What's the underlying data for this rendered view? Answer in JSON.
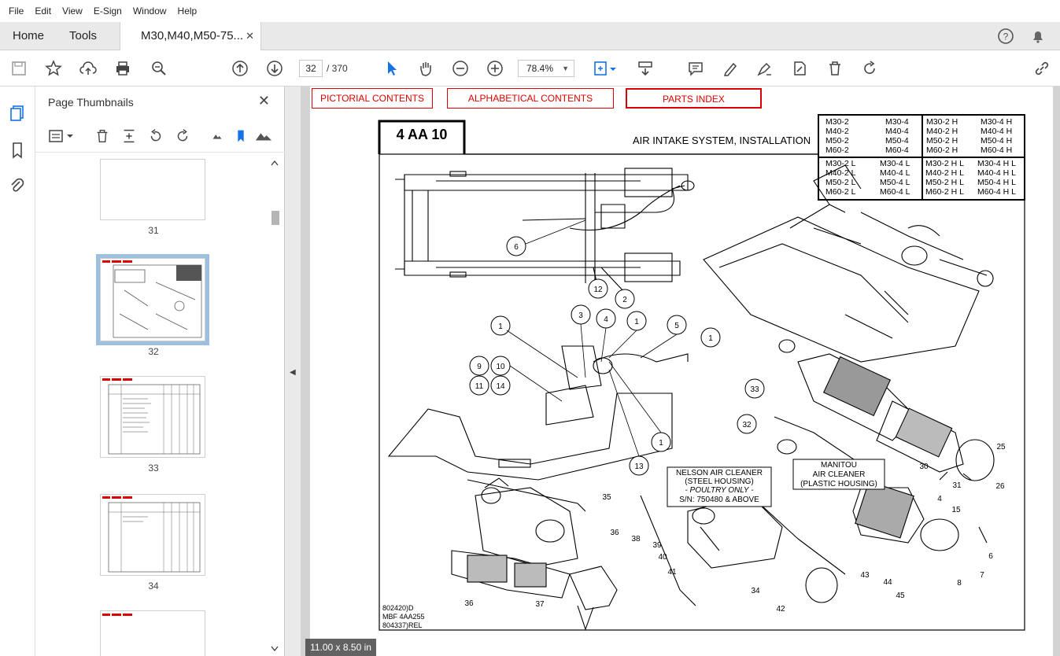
{
  "menu": [
    "File",
    "Edit",
    "View",
    "E-Sign",
    "Window",
    "Help"
  ],
  "tabs": {
    "home": "Home",
    "tools": "Tools",
    "document": "M30,M40,M50-75...",
    "close": "✕"
  },
  "toolbar": {
    "page_current": "32",
    "page_total": "/ 370",
    "zoom": "78.4%"
  },
  "panel": {
    "title": "Page Thumbnails",
    "close": "✕",
    "thumbnails": [
      {
        "label": "31"
      },
      {
        "label": "32",
        "selected": true
      },
      {
        "label": "33"
      },
      {
        "label": "34"
      }
    ]
  },
  "document": {
    "nav": [
      "PICTORIAL CONTENTS",
      "ALPHABETICAL CONTENTS",
      "PARTS INDEX"
    ],
    "section_code": "4 AA 10",
    "section_title": "AIR INTAKE SYSTEM, INSTALLATION",
    "models": {
      "r1c1": [
        "M30-2",
        "M40-2",
        "M50-2",
        "M60-2"
      ],
      "r1c2": [
        "M30-4",
        "M40-4",
        "M50-4",
        "M60-4"
      ],
      "r1c3": [
        "M30-2 H",
        "M40-2 H",
        "M50-2 H",
        "M60-2 H"
      ],
      "r1c4": [
        "M30-4 H",
        "M40-4 H",
        "M50-4 H",
        "M60-4 H"
      ],
      "r2c1": [
        "M30-2 L",
        "M40-2 L",
        "M50-2 L",
        "M60-2 L"
      ],
      "r2c2": [
        "M30-4 L",
        "M40-4 L",
        "M50-4 L",
        "M60-4 L"
      ],
      "r2c3": [
        "M30-2 H L",
        "M40-2 H L",
        "M50-2 H L",
        "M60-2 H L"
      ],
      "r2c4": [
        "M30-4 H L",
        "M40-4 H L",
        "M50-4 H L",
        "M60-4 H L"
      ]
    },
    "nelson_label": [
      "NELSON AIR CLEANER",
      "(STEEL HOUSING)",
      "- POULTRY ONLY -",
      "S/N: 750480 & ABOVE"
    ],
    "manitou_label": [
      "MANITOU",
      "AIR CLEANER",
      "(PLASTIC HOUSING)"
    ],
    "footer_refs": [
      "802420)D",
      "MBF 4AA255",
      "804337)REL"
    ],
    "callouts_circled": [
      "6",
      "12",
      "2",
      "3",
      "4",
      "1",
      "5",
      "1",
      "1",
      "9",
      "10",
      "11",
      "14",
      "1",
      "13",
      "33",
      "32"
    ],
    "callouts_plain": [
      "35",
      "36",
      "38",
      "39",
      "40",
      "41",
      "36",
      "37",
      "34",
      "42",
      "43",
      "44",
      "45",
      "25",
      "30",
      "31",
      "26",
      "4",
      "15",
      "6",
      "7",
      "8"
    ]
  },
  "status": {
    "page_size": "11.00 x 8.50 in"
  },
  "colors": {
    "accent": "#1473e6",
    "nav_red": "#dd0000",
    "selection": "#9dbfe0"
  }
}
